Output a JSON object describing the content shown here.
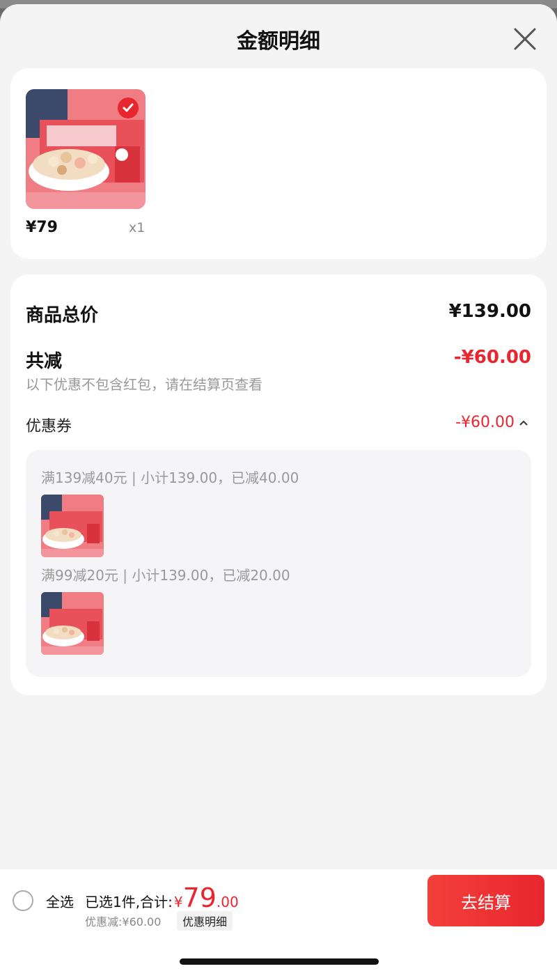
{
  "modal": {
    "title": "金额明细"
  },
  "product": {
    "price": "¥79",
    "quantity": "x1",
    "selected": true
  },
  "detail": {
    "total_label": "商品总价",
    "total_value": "¥139.00",
    "reduce_label": "共减",
    "reduce_value": "-¥60.00",
    "note": "以下优惠不包含红包，请在结算页查看",
    "coupon_label": "优惠券",
    "coupon_value": "-¥60.00",
    "coupon_expand_icon": "chevron-up-icon",
    "coupons": [
      {
        "rule": "满139减40元 | 小计139.00，已减40.00"
      },
      {
        "rule": "满99减20元 | 小计139.00，已减20.00"
      }
    ]
  },
  "bottom": {
    "select_all": "全选",
    "selected_summary": "已选1件,合计:",
    "total_symbol": "¥",
    "total_integer": "79",
    "total_decimal": ".00",
    "discount": "优惠减:¥60.00",
    "detail_chip": "优惠明细",
    "checkout": "去结算"
  },
  "colors": {
    "accent": "#e8262f",
    "background": "#f4f4f4",
    "card": "#ffffff"
  }
}
